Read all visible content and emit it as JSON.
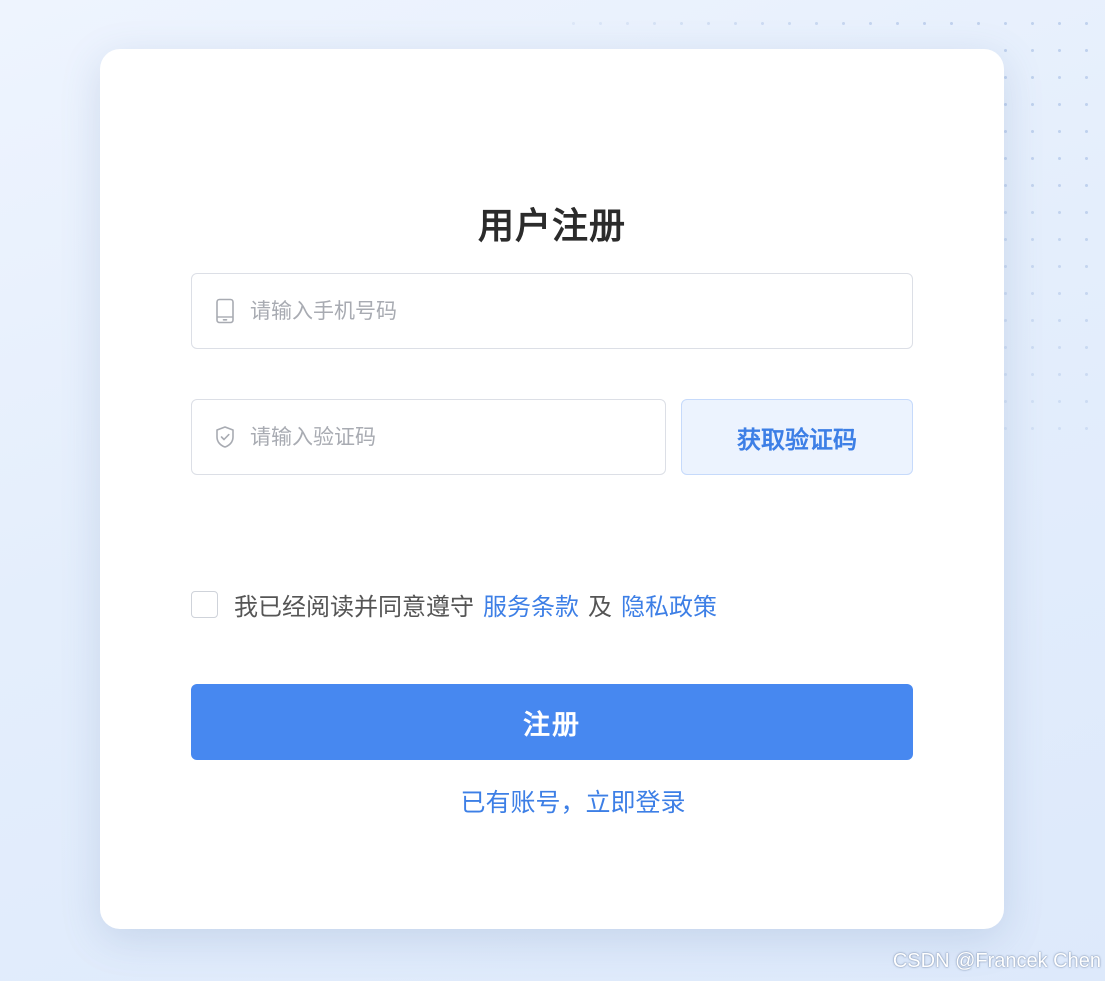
{
  "page": {
    "title": "用户注册"
  },
  "form": {
    "phone": {
      "icon": "mobile-phone-icon",
      "placeholder": "请输入手机号码",
      "value": ""
    },
    "code": {
      "icon": "shield-check-icon",
      "placeholder": "请输入验证码",
      "value": ""
    },
    "get_code_label": "获取验证码",
    "agreement": {
      "checked": false,
      "text": "我已经阅读并同意遵守",
      "terms_label": "服务条款",
      "and_label": "及",
      "privacy_label": "隐私政策"
    },
    "submit_label": "注册",
    "login_link_label": "已有账号，立即登录"
  },
  "watermark": "CSDN @Francek Chen",
  "colors": {
    "accent": "#4788f0",
    "link": "#3d7fe6",
    "code_button_bg": "#ecf3fe",
    "card_bg": "#ffffff"
  }
}
